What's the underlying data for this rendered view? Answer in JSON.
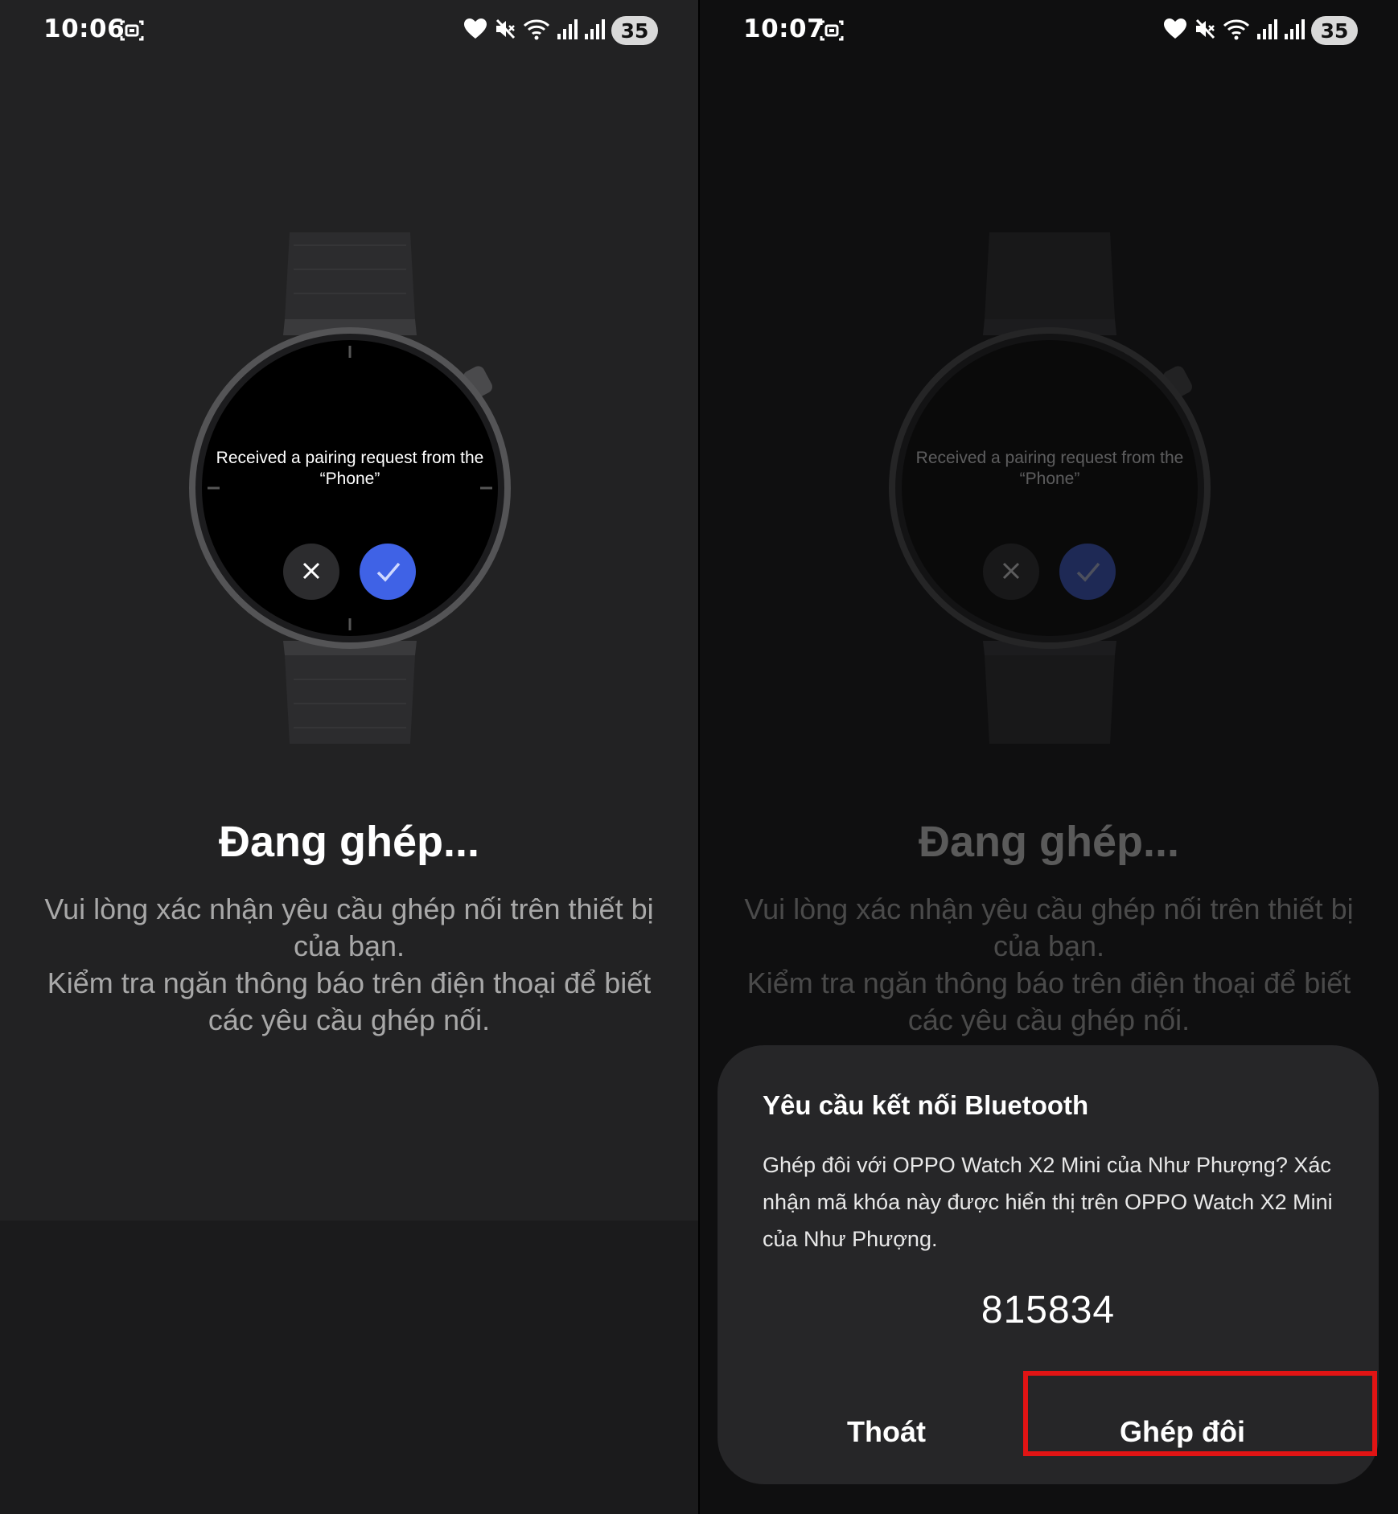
{
  "left_screen": {
    "status_bar": {
      "time": "10:06",
      "battery": "35"
    },
    "watch_message": "Received a pairing request from the “Phone”",
    "title": "Đang ghép...",
    "description": "Vui lòng xác nhận yêu cầu ghép nối trên thiết bị của bạn.\nKiểm tra ngăn thông báo trên điện thoại để biết các yêu cầu ghép nối."
  },
  "right_screen": {
    "status_bar": {
      "time": "10:07",
      "battery": "35"
    },
    "watch_message": "Received a pairing request from the “Phone”",
    "title": "Đang ghép...",
    "description": "Vui lòng xác nhận yêu cầu ghép nối trên thiết bị của bạn.\nKiểm tra ngăn thông báo trên điện thoại để biết các yêu cầu ghép nối.",
    "dialog": {
      "title": "Yêu cầu kết nối Bluetooth",
      "body": "Ghép đôi với OPPO Watch X2 Mini của Như Phượng? Xác nhận mã khóa này được hiển thị trên OPPO Watch X2 Mini của Như Phượng.",
      "passkey": "815834",
      "cancel_label": "Thoát",
      "pair_label": "Ghép đôi"
    }
  },
  "colors": {
    "highlight": "#e11414",
    "watch_confirm": "#3f62e6",
    "background": "#222223"
  },
  "icons": [
    "screenshot-icon",
    "heart-icon",
    "mute-icon",
    "wifi-icon",
    "signal-icon",
    "battery-icon",
    "close-icon",
    "check-icon"
  ]
}
